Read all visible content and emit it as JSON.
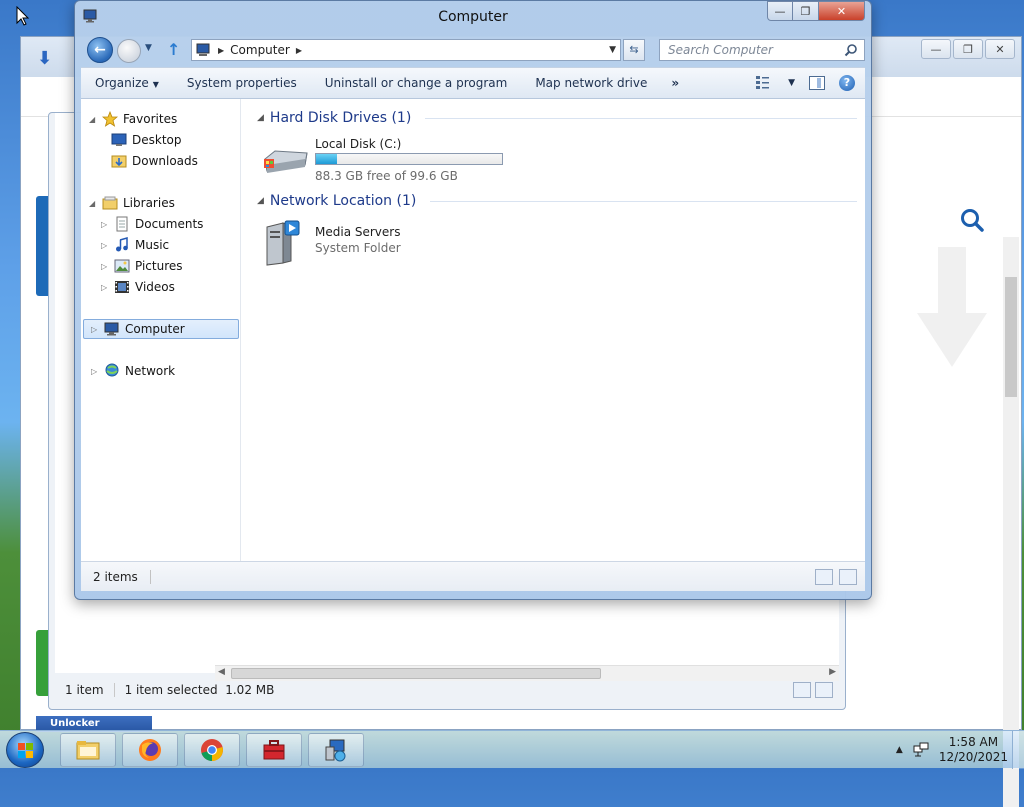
{
  "colors": {
    "accent_blue": "#1e3a8a",
    "selection_bg": "#d2e5fb",
    "drive_fill": "#1d9ad6",
    "close_red": "#c9412a"
  },
  "background_explorer": {
    "status": {
      "item_count": "1 item",
      "selected": "1 item selected",
      "size": "1.02 MB"
    },
    "unlocker_label": "Unlocker"
  },
  "explorer": {
    "title": "Computer",
    "address": {
      "crumb": "Computer"
    },
    "search": {
      "placeholder": "Search Computer"
    },
    "commands": {
      "organize": "Organize",
      "system_properties": "System properties",
      "uninstall": "Uninstall or change a program",
      "map_drive": "Map network drive",
      "more": "»"
    },
    "nav_tree": {
      "favorites": "Favorites",
      "desktop": "Desktop",
      "downloads": "Downloads",
      "libraries": "Libraries",
      "documents": "Documents",
      "music": "Music",
      "pictures": "Pictures",
      "videos": "Videos",
      "computer": "Computer",
      "network": "Network"
    },
    "groups": {
      "hard_disk": "Hard Disk Drives (1)",
      "network_location": "Network Location (1)"
    },
    "drive": {
      "name": "Local Disk (C:)",
      "free_text": "88.3 GB free of 99.6 GB",
      "used_fraction": 0.113
    },
    "network_item": {
      "name": "Media Servers",
      "type": "System Folder"
    },
    "status": {
      "item_count": "2 items"
    }
  },
  "taskbar": {
    "clock_time": "1:58 AM",
    "clock_date": "12/20/2021",
    "buttons": [
      "windows-explorer",
      "firefox",
      "chrome",
      "toolbox",
      "network-install"
    ]
  }
}
